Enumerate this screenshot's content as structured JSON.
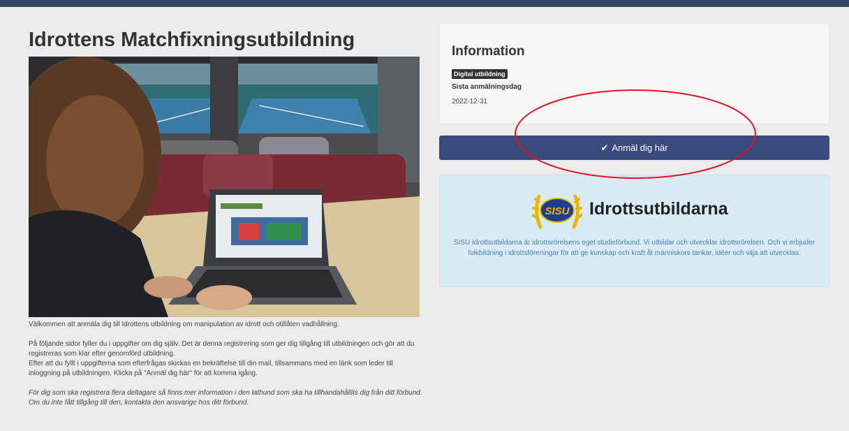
{
  "page": {
    "title": "Idrottens Matchfixningsutbildning",
    "intro_paragraphs": [
      "Välkommen att anmäla dig till Idrottens utbildning om manipulation av idrott och otillåten vadhållning.",
      "På följande sidor fyller du i uppgifter om dig själv. Det är denna registrering som ger dig tillgång till utbildningen och gör att du registreras som klar efter genomförd utbildning.",
      "Efter att du fyllt i uppgifterna som efterfrågas skickas en bekräftelse till din mail, tillsammans med en länk som leder till inloggning på utbildningen. Klicka på \"Anmäl dig här\" för att komma igång.",
      "För dig som ska registrera flera deltagare så finns mer information i den lathund som ska ha tillhandahållits dig från ditt förbund. Om du inte fått tillgång till den, kontakta den ansvarige hos ditt förbund."
    ]
  },
  "info": {
    "heading": "Information",
    "badge": "Digital utbildning",
    "deadline_label": "Sista anmälningsdag",
    "deadline_value": "2022-12-31"
  },
  "register_button": {
    "label": "Anmäl dig här",
    "icon": "check-icon"
  },
  "sisu": {
    "logo_text": "SISU",
    "name": "Idrottsutbildarna",
    "description": "SISU Idrottsutbildarna är idrottsrörelsens eget studieförbund. Vi utbildar och utvecklar idrottsrörelsen. Och vi erbjuder folkbildning i idrottsföreningar för att ge kunskap och kraft åt människors tankar, idéer och vilja att utvecklas."
  },
  "colors": {
    "topbar": "#34475e",
    "button": "#3b4a7c",
    "sisu_panel": "#d8ebf6",
    "sisu_text": "#4a7fa5",
    "annotation": "#e0141e"
  }
}
